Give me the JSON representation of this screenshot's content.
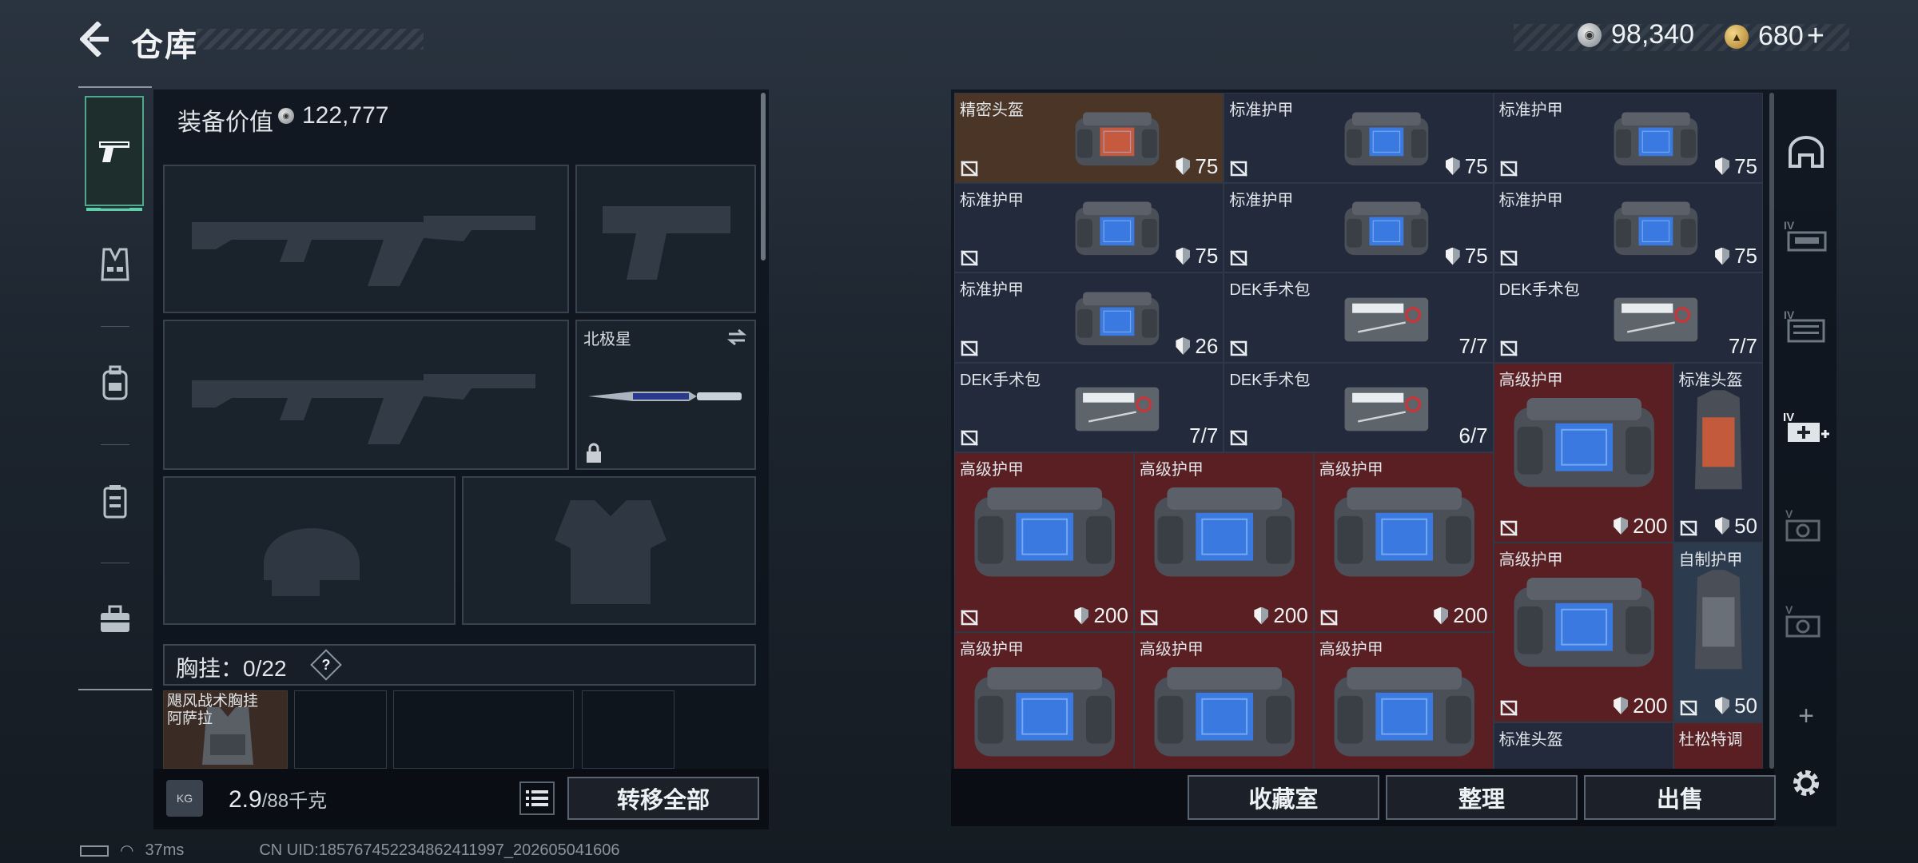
{
  "header": {
    "back_icon": "chevron-left-icon",
    "title": "仓库",
    "currencies": [
      {
        "icon": "silver-coin-icon",
        "value": "98,340"
      },
      {
        "icon": "gold-coin-icon",
        "value": "680"
      }
    ],
    "add_symbol": "+"
  },
  "left_nav": {
    "items": [
      {
        "name": "weapons-tab",
        "icon": "pistol-icon",
        "active": true
      },
      {
        "name": "rig-tab",
        "icon": "vest-icon",
        "active": false
      },
      {
        "name": "backpack-tab",
        "icon": "backpack-icon",
        "active": false
      },
      {
        "name": "container-tab",
        "icon": "case-icon",
        "active": false
      },
      {
        "name": "toolbox-tab",
        "icon": "toolbox-icon",
        "active": false
      }
    ]
  },
  "loadout": {
    "equip_value_label": "装备价值",
    "equip_value": "122,777",
    "melee_slot_label": "北极星",
    "rig_label": "胸挂：",
    "rig_count": "0/22",
    "help_label": "?",
    "rig_item_label": "飓风战术胸挂\n阿萨拉",
    "weight_value": "2.9",
    "weight_cap": "/88千克",
    "weight_icon_label": "KG",
    "transfer_all": "转移全部"
  },
  "stash": {
    "items": [
      {
        "name": "精密头盔",
        "value": "75",
        "type": "durability",
        "tint": "brown",
        "img": "vest-orange"
      },
      {
        "name": "标准护甲",
        "value": "75",
        "type": "durability",
        "tint": "navy",
        "img": "vest-blue"
      },
      {
        "name": "标准护甲",
        "value": "75",
        "type": "durability",
        "tint": "navy",
        "img": "vest-blue"
      },
      {
        "name": "标准护甲",
        "value": "75",
        "type": "durability",
        "tint": "navy",
        "img": "vest-blue"
      },
      {
        "name": "标准护甲",
        "value": "75",
        "type": "durability",
        "tint": "navy",
        "img": "vest-blue"
      },
      {
        "name": "标准护甲",
        "value": "75",
        "type": "durability",
        "tint": "navy",
        "img": "vest-blue"
      },
      {
        "name": "标准护甲",
        "value": "26",
        "type": "durability",
        "tint": "navy",
        "img": "vest-blue"
      },
      {
        "name": "DEK手术包",
        "value": "7/7",
        "type": "uses",
        "tint": "navy",
        "img": "kit"
      },
      {
        "name": "DEK手术包",
        "value": "7/7",
        "type": "uses",
        "tint": "navy",
        "img": "kit"
      },
      {
        "name": "DEK手术包",
        "value": "7/7",
        "type": "uses",
        "tint": "navy",
        "img": "kit"
      },
      {
        "name": "DEK手术包",
        "value": "6/7",
        "type": "uses",
        "tint": "navy",
        "img": "kit"
      },
      {
        "name": "高级护甲",
        "value": "200",
        "type": "durability",
        "tint": "red",
        "img": "vest-big"
      },
      {
        "name": "标准头盔",
        "value": "50",
        "type": "durability",
        "tint": "navy",
        "img": "vest-slim-orange"
      },
      {
        "name": "高级护甲",
        "value": "200",
        "type": "durability",
        "tint": "red",
        "img": "vest-big"
      },
      {
        "name": "高级护甲",
        "value": "200",
        "type": "durability",
        "tint": "red",
        "img": "vest-big"
      },
      {
        "name": "高级护甲",
        "value": "200",
        "type": "durability",
        "tint": "red",
        "img": "vest-big"
      },
      {
        "name": "高级护甲",
        "value": "200",
        "type": "durability",
        "tint": "red",
        "img": "vest-big"
      },
      {
        "name": "自制护甲",
        "value": "50",
        "type": "durability",
        "tint": "steel",
        "img": "vest-slim"
      },
      {
        "name": "高级护甲",
        "value": "",
        "type": "durability",
        "tint": "red",
        "img": "vest-big"
      },
      {
        "name": "高级护甲",
        "value": "",
        "type": "durability",
        "tint": "red",
        "img": "vest-big"
      },
      {
        "name": "高级护甲",
        "value": "",
        "type": "durability",
        "tint": "red",
        "img": "vest-big"
      },
      {
        "name": "标准头盔",
        "value": "",
        "type": "durability",
        "tint": "navy",
        "img": "none"
      },
      {
        "name": "杜松特调",
        "value": "",
        "type": "uses",
        "tint": "red",
        "img": "none"
      }
    ],
    "buttons": {
      "collection": "收藏室",
      "organize": "整理",
      "sell": "出售"
    }
  },
  "right_nav": {
    "items": [
      "arch-icon",
      "stash-iv-icon-1",
      "stash-iv-icon-2",
      "stash-iv-add-icon",
      "stash-v-icon-1",
      "stash-v-icon-2",
      "plus-icon",
      "gear-icon"
    ],
    "plus": "+"
  },
  "status_bar": {
    "ping": "37ms",
    "uid": "CN UID:18576745223486241199​7_202605041606"
  },
  "colors": {
    "accent_green": "#5cd0a6",
    "tint_red": "#5a1f22",
    "tint_navy": "#222a3c",
    "tint_brown": "#4b3526",
    "tint_steel": "#2c3c4e"
  }
}
